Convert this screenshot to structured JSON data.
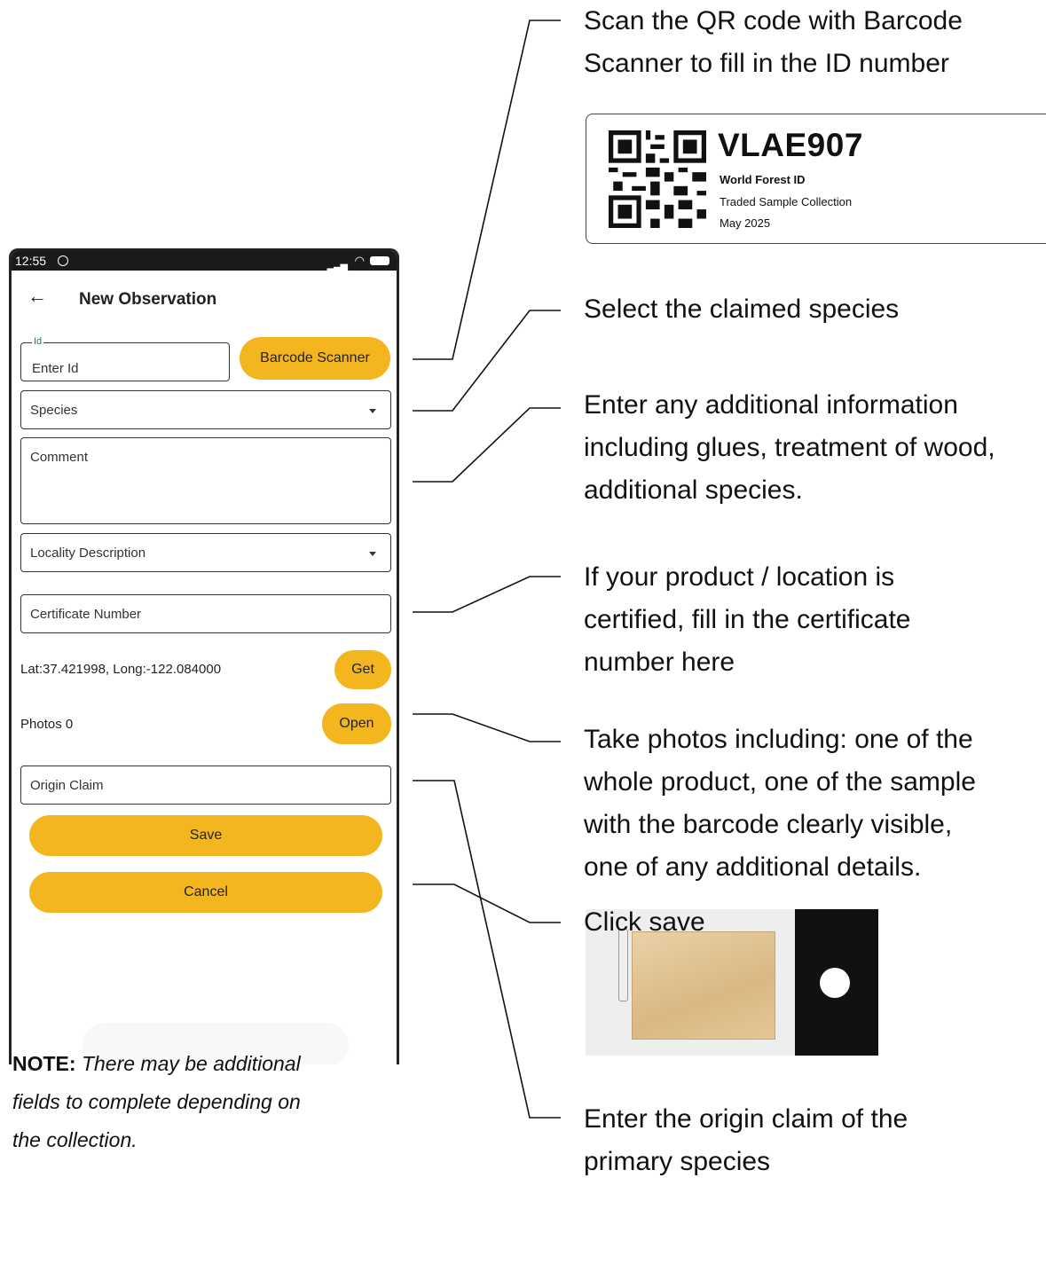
{
  "phone": {
    "status": {
      "time": "12:55"
    },
    "appbar": {
      "title": "New Observation"
    },
    "id_field": {
      "label": "Id",
      "placeholder": "Enter Id"
    },
    "barcode_button": "Barcode Scanner",
    "species_field": "Species",
    "comment_field": "Comment",
    "locality_field": "Locality Description",
    "certificate_field": "Certificate Number",
    "location_text": "Lat:37.421998, Long:-122.084000",
    "get_button": "Get",
    "photos_text": "Photos 0",
    "open_button": "Open",
    "origin_field": "Origin Claim",
    "save_button": "Save",
    "cancel_button": "Cancel"
  },
  "annotations": {
    "scan": [
      "Scan the QR code with Barcode",
      "Scanner to fill in the ID number"
    ],
    "species": [
      "Select the claimed species"
    ],
    "comment": [
      "Enter any additional information",
      "including glues, treatment of wood,",
      "additional species."
    ],
    "certificate": [
      "If your product / location is",
      "certified, fill in the certificate",
      "number here"
    ],
    "photos": [
      "Take photos including: one of the",
      "whole product, one of the sample",
      "with the barcode clearly visible,",
      "one of any additional details."
    ],
    "origin": [
      "Enter the origin claim of the",
      "primary species"
    ],
    "save": [
      "Click save"
    ]
  },
  "qr_card": {
    "code": "VLAE907",
    "line1": "World Forest ID",
    "line2": "Traded Sample Collection",
    "line3": "May 2025"
  },
  "note": {
    "label": "NOTE:",
    "text_1": "There may be additional",
    "text_2": "fields to complete depending on",
    "text_3": "the collection."
  }
}
